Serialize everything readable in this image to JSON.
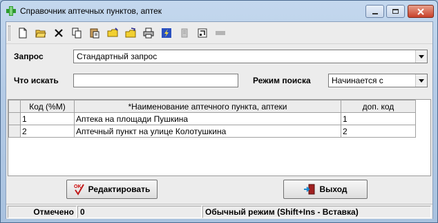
{
  "window": {
    "title": "Справочник аптечных пунктов, аптек"
  },
  "toolbar": {
    "icons": [
      "new-icon",
      "open-icon",
      "delete-icon",
      "copy-icon",
      "paste-icon",
      "folder-icon",
      "edit-folder-icon",
      "print-icon",
      "lightning-icon",
      "disabled-icon",
      "calc-icon",
      "minus-icon"
    ]
  },
  "query": {
    "label": "Запрос",
    "value": "Стандартный запрос"
  },
  "search": {
    "label": "Что искать",
    "value": "",
    "mode_label": "Режим поиска",
    "mode_value": "Начинается с"
  },
  "grid": {
    "columns": [
      "Код (%M)",
      "*Наименование аптечного пункта, аптеки",
      "доп. код"
    ],
    "rows": [
      {
        "code": "1",
        "name": "Аптека на площади Пушкина",
        "extra": "1"
      },
      {
        "code": "2",
        "name": "Аптечный пункт на улице Колотушкина",
        "extra": "2"
      }
    ]
  },
  "buttons": {
    "edit": "Редактировать",
    "exit": "Выход"
  },
  "status": {
    "marked_label": "Отмечено",
    "marked_value": "0",
    "mode": "Обычный режим (Shift+Ins - Вставка)"
  },
  "colors": {
    "accent_green": "#2e9a2e",
    "close_red": "#c8412a"
  }
}
